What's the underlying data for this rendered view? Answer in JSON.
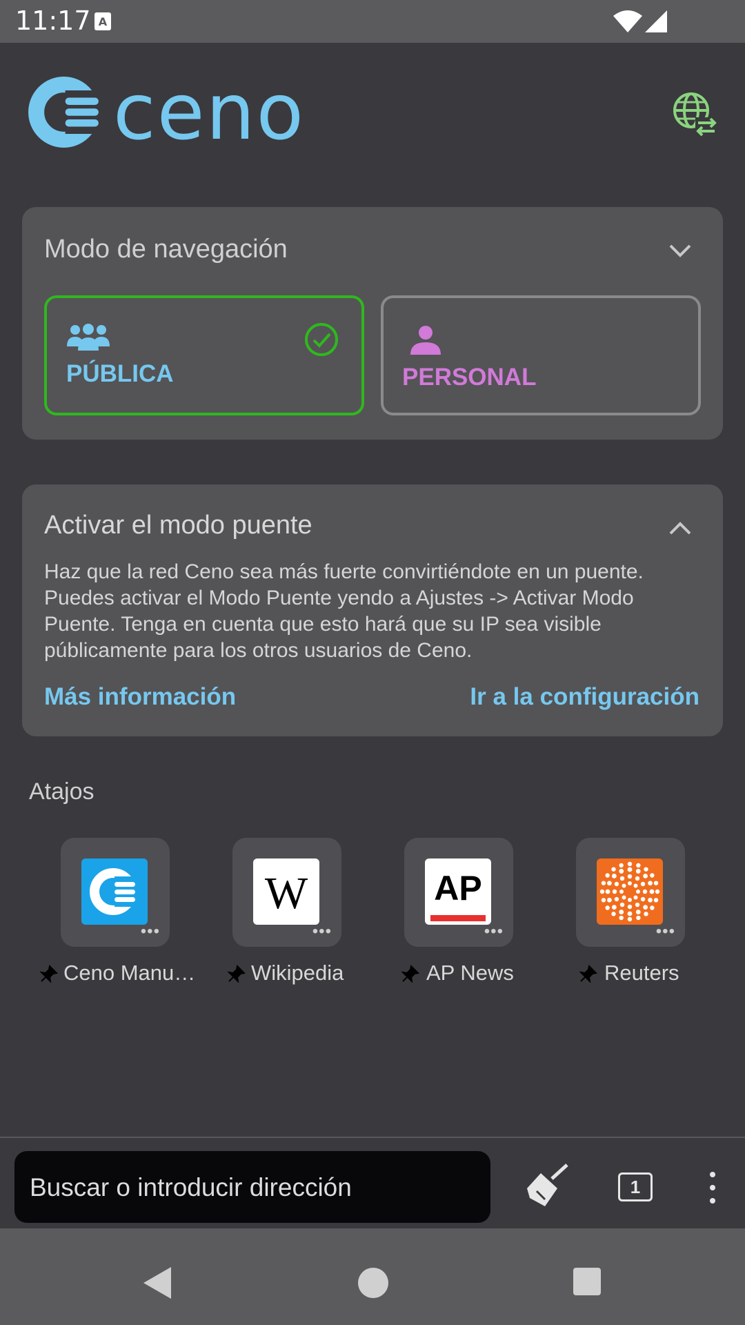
{
  "status": {
    "time": "11:17"
  },
  "brand": {
    "name": "ceno"
  },
  "browsing_mode": {
    "title": "Modo de navegación",
    "public_label": "PÚBLICA",
    "personal_label": "PERSONAL",
    "selected": "PÚBLICA"
  },
  "bridge": {
    "title": "Activar el modo puente",
    "description": "Haz que la red Ceno sea más fuerte convirtiéndote en un puente. Puedes activar el Modo Puente yendo a Ajustes -> Activar Modo Puente. Tenga en cuenta que esto hará que su IP sea visible públicamente para los otros usuarios de Ceno.",
    "more_info": "Más información",
    "go_settings": "Ir a la configuración"
  },
  "shortcuts": {
    "title": "Atajos",
    "items": [
      {
        "label": "Ceno Manu…",
        "icon": "ceno-icon"
      },
      {
        "label": "Wikipedia",
        "icon": "wikipedia-icon"
      },
      {
        "label": "AP News",
        "icon": "ap-news-icon"
      },
      {
        "label": "Reuters",
        "icon": "reuters-icon"
      }
    ]
  },
  "toolbar": {
    "search_placeholder": "Buscar o introducir dirección",
    "tab_count": "1"
  },
  "colors": {
    "accent_blue": "#76c8ef",
    "public_green": "#2fb81e",
    "personal_purple": "#d17ad8",
    "globe_green": "#8bd47e"
  }
}
